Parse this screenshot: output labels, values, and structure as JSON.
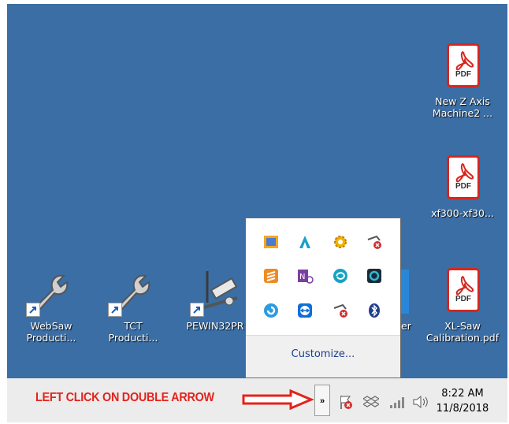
{
  "desktop": {
    "icons": [
      {
        "label_line1": "WebSaw",
        "label_line2": "Producti...",
        "icon": "wrench-icon"
      },
      {
        "label_line1": "TCT",
        "label_line2": "Producti...",
        "icon": "wrench-icon"
      },
      {
        "label_line1": "PEWIN32PR",
        "label_line2": "",
        "icon": "syringe-icon"
      },
      {
        "label_line1": "er",
        "label_line2": "",
        "icon": "partial-icon"
      },
      {
        "label_line1": "New Z Axis",
        "label_line2": "Machine2 ...",
        "icon": "pdf-icon"
      },
      {
        "label_line1": "xf300-xf30...",
        "label_line2": "",
        "icon": "pdf-icon"
      },
      {
        "label_line1": "XL-Saw",
        "label_line2": "Calibration.pdf",
        "icon": "pdf-icon"
      }
    ],
    "pdf_badge": "PDF"
  },
  "tray_popup": {
    "icons": [
      "folder-app-icon",
      "autodesk-icon",
      "sun-gear-icon",
      "network-error-icon",
      "sublime-icon",
      "onenote-icon",
      "seagate-icon",
      "quickbooks-icon",
      "refresh-icon",
      "teamviewer-icon",
      "network-error-icon",
      "bluetooth-icon"
    ],
    "customize_label": "Customize..."
  },
  "taskbar": {
    "instruction": "LEFT CLICK ON DOUBLE ARROW",
    "expand_glyph": "»",
    "clock_time": "8:22 AM",
    "clock_date": "11/8/2018",
    "tray_icons": [
      "action-center-flag-icon",
      "dropbox-icon",
      "signal-icon",
      "volume-icon"
    ]
  },
  "colors": {
    "desktop": "#3a6ea5",
    "annotation": "#e3231d",
    "pdf_red": "#d7261e"
  }
}
